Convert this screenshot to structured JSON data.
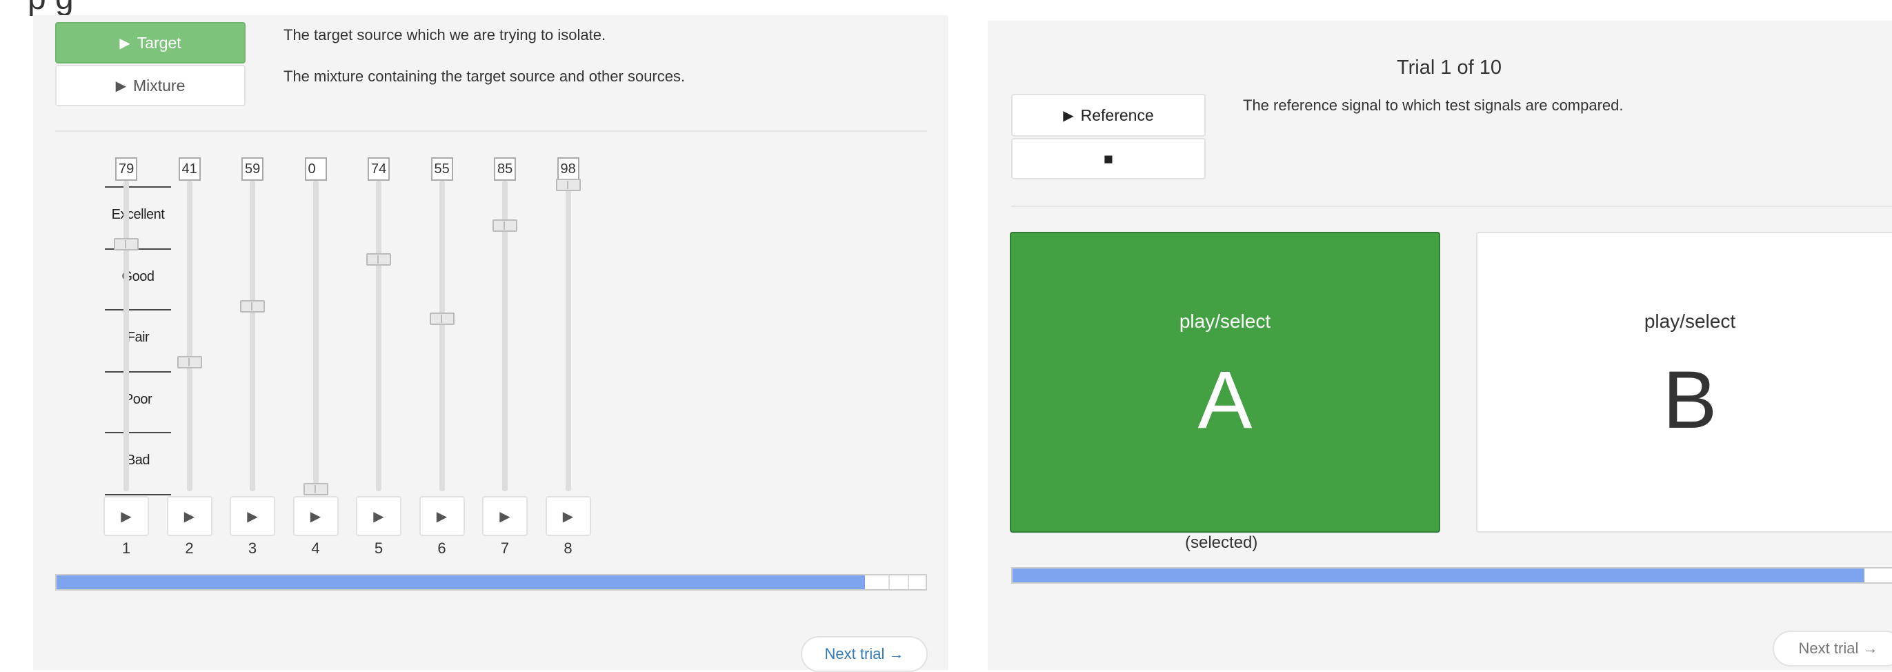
{
  "left": {
    "target_label": "Target",
    "mixture_label": "Mixture",
    "target_desc": "The target source which we are trying to isolate.",
    "mixture_desc": "The mixture containing the target source and other sources.",
    "scale": [
      "Excellent",
      "Good",
      "Fair",
      "Poor",
      "Bad"
    ],
    "sliders": [
      {
        "value": "79",
        "number": "1"
      },
      {
        "value": "41",
        "number": "2"
      },
      {
        "value": "59",
        "number": "3"
      },
      {
        "value": "0",
        "number": "4"
      },
      {
        "value": "74",
        "number": "5"
      },
      {
        "value": "55",
        "number": "6"
      },
      {
        "value": "85",
        "number": "7"
      },
      {
        "value": "98",
        "number": "8"
      }
    ],
    "progress": 0.93,
    "next_label": "Next trial →"
  },
  "right": {
    "title": "Trial 1 of 10",
    "reference_label": "Reference",
    "stop_glyph": "■",
    "reference_desc": "The reference signal to which test signals are compared.",
    "choice_a": {
      "action": "play/select",
      "letter": "A",
      "status": "(selected)"
    },
    "choice_b": {
      "action": "play/select",
      "letter": "B"
    },
    "progress": 0.96,
    "next_label": "Next trial →"
  },
  "icons": {
    "play": "▶",
    "stop": "■"
  },
  "colors": {
    "selected": "#43a043",
    "target_active": "#7dc37b",
    "progress": "#7ea4ef",
    "link": "#337ab7"
  }
}
